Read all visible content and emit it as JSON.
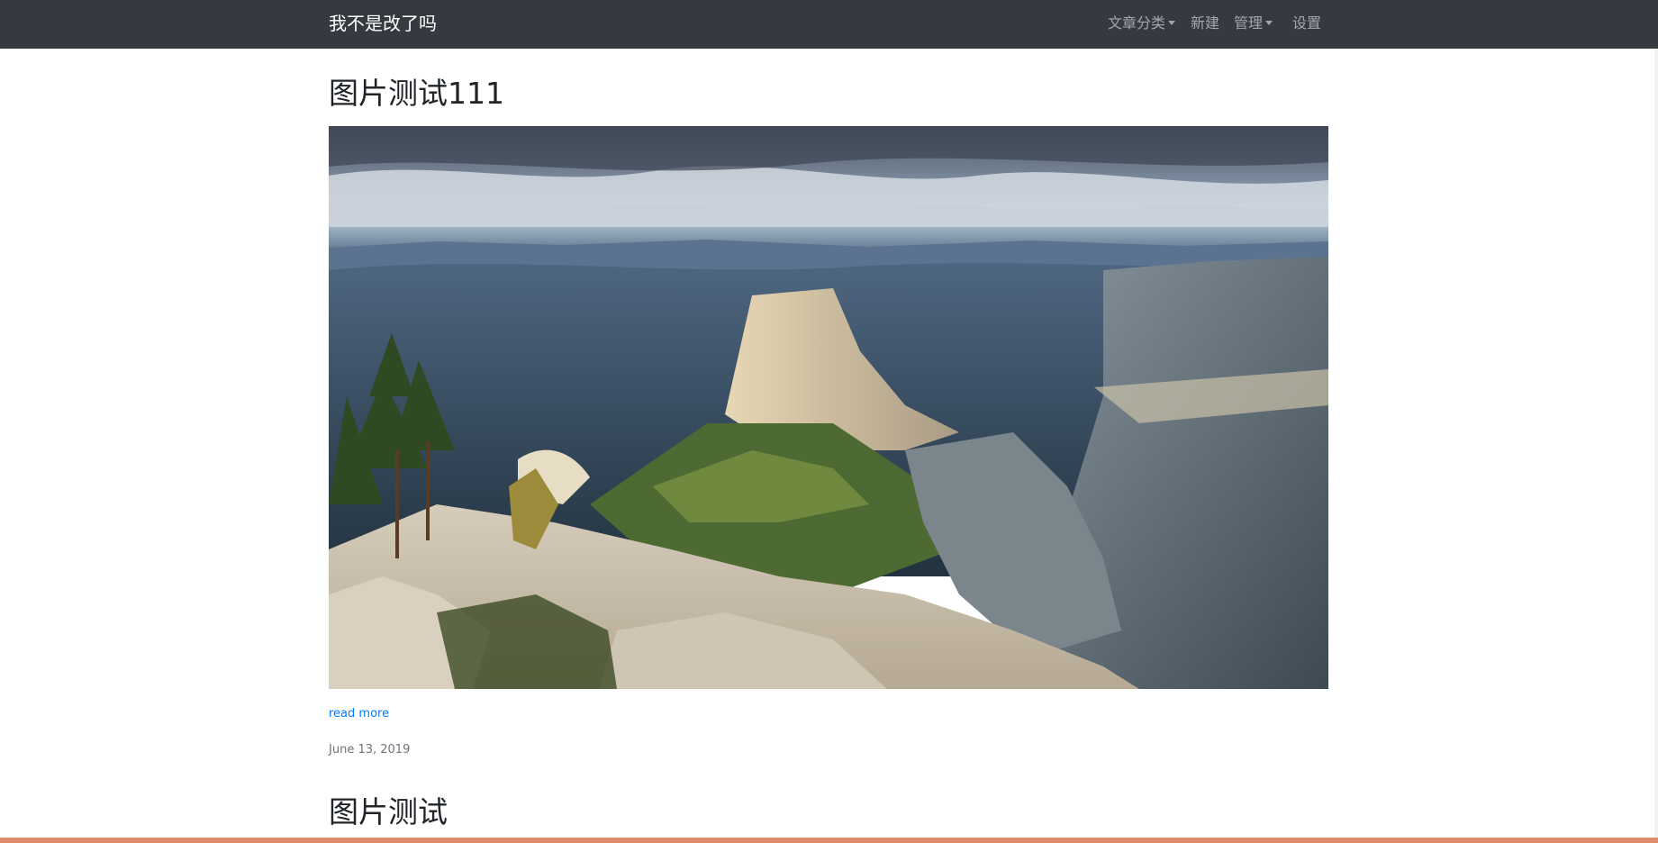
{
  "navbar": {
    "brand": "我不是改了吗",
    "items": [
      {
        "label": "文章分类",
        "dropdown": true
      },
      {
        "label": "新建",
        "dropdown": false
      },
      {
        "label": "管理",
        "dropdown": true
      },
      {
        "label": "设置",
        "dropdown": false
      }
    ]
  },
  "posts": [
    {
      "title": "图片测试111",
      "image_alt": "mountain-valley-landscape",
      "read_more": "read more",
      "date": "June 13, 2019"
    },
    {
      "title": "图片测试"
    }
  ],
  "colors": {
    "navbar_bg": "#343a40",
    "link": "#007bff",
    "date": "#6c757d",
    "bottom_bar": "#e08b6a"
  }
}
